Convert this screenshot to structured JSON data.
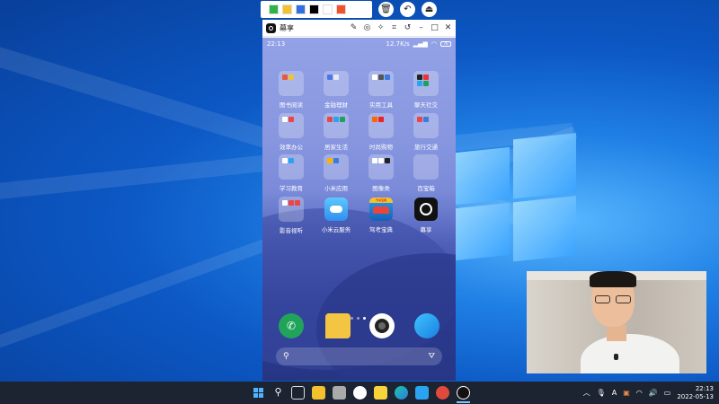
{
  "toolbar": {
    "swatches": [
      "#2fb344",
      "#f2c12e",
      "#2f6fe0",
      "#000000",
      "#ffffff",
      "#f4502a"
    ]
  },
  "window": {
    "title": "幕享"
  },
  "phone": {
    "time": "22:13",
    "net_speed": "12.7K/s",
    "battery": "76",
    "folders": [
      {
        "label": "图书阅读"
      },
      {
        "label": "金融理财"
      },
      {
        "label": "实用工具"
      },
      {
        "label": "聊天社交"
      },
      {
        "label": "效率办公"
      },
      {
        "label": "居家生活"
      },
      {
        "label": "时尚购物"
      },
      {
        "label": "旅行交通"
      },
      {
        "label": "学习教育"
      },
      {
        "label": "小米应用"
      },
      {
        "label": "图像类"
      },
      {
        "label": "百宝箱"
      },
      {
        "label": "影音视听"
      }
    ],
    "apps": [
      {
        "label": "小米云服务"
      },
      {
        "label": "驾考宝典"
      },
      {
        "label": "幕享"
      }
    ],
    "car_badge": "驾考宝典"
  },
  "taskbar": {
    "ime": "A",
    "time": "22:13",
    "date": "2022-05-13"
  },
  "colors": {
    "desktop_accent": "#1f7fe4",
    "taskbar": "#1c2431",
    "phone_dock_phone": "#21a35a",
    "phone_dock_notes": "#f4c542"
  }
}
